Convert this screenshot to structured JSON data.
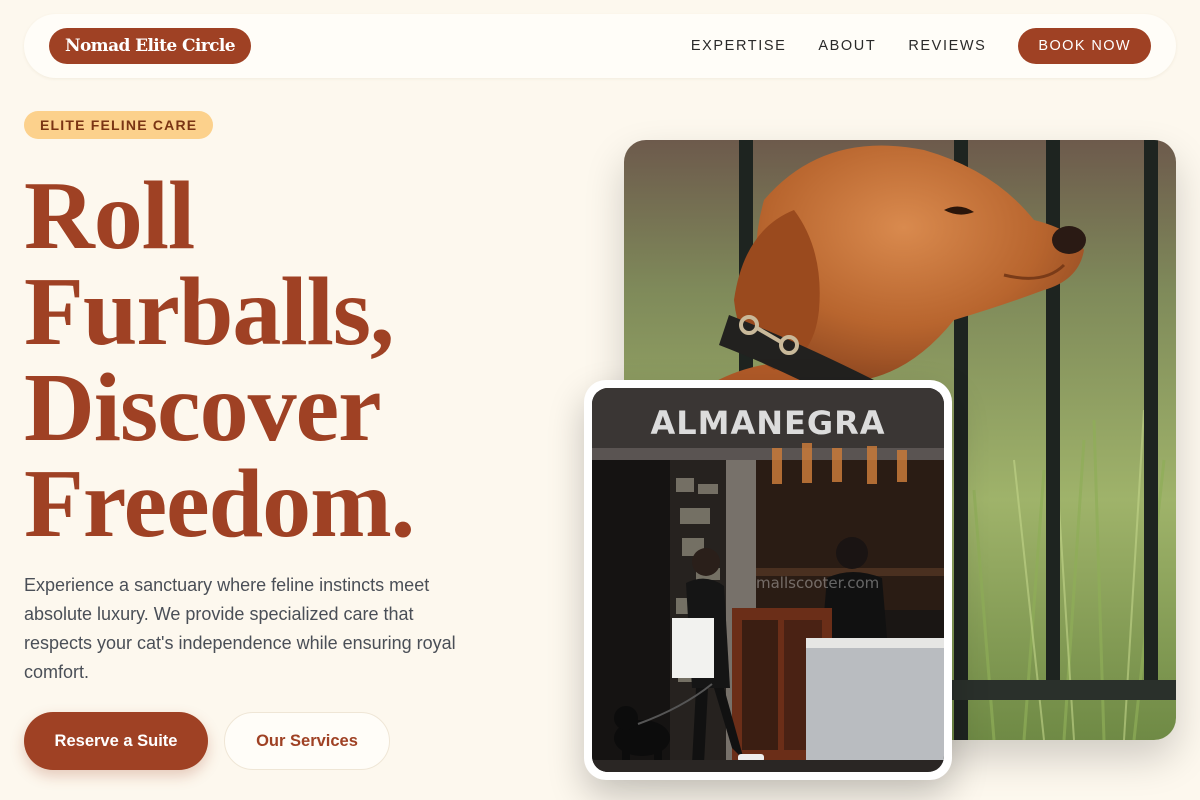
{
  "nav": {
    "brand": "Nomad Elite Circle",
    "links": [
      "EXPERTISE",
      "ABOUT",
      "REVIEWS"
    ],
    "cta": "BOOK NOW"
  },
  "hero": {
    "badge": "ELITE FELINE CARE",
    "headline_lines": [
      "Roll",
      "Furballs,",
      "Discover",
      "Freedom."
    ],
    "description": "Experience a sanctuary where feline instincts meet absolute luxury. We provide specialized care that respects your cat's independence while ensuring royal comfort.",
    "primary_button": "Reserve a Suite",
    "secondary_button": "Our Services"
  },
  "photos": {
    "cafe_sign": "ALMANEGRA",
    "watermark": "mallscooter.com"
  },
  "colors": {
    "background": "#fdf8ee",
    "brand": "#9f4124",
    "badge": "#fcd18c"
  }
}
